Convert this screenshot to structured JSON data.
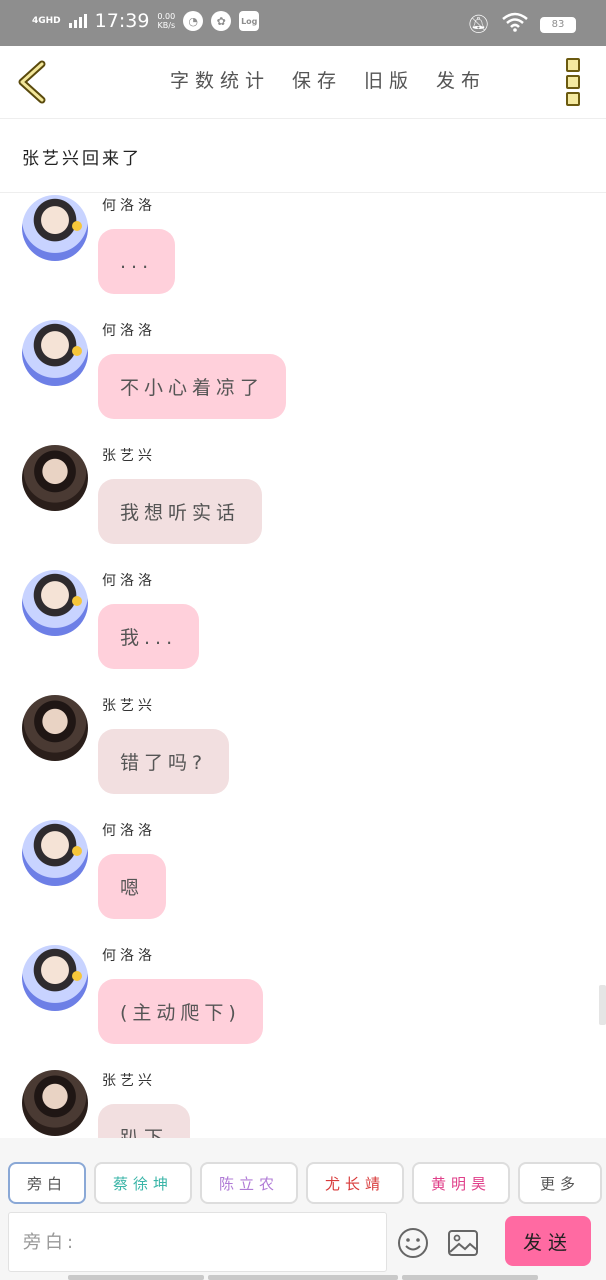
{
  "status_bar": {
    "network": "4GHD",
    "time": "17:39",
    "speed_value": "0.00",
    "speed_unit": "KB/s",
    "app_icon_log": "Log",
    "battery": "83"
  },
  "toolbar": {
    "actions": [
      "字数统计",
      "保存",
      "旧版",
      "发布"
    ]
  },
  "title": "张艺兴回来了",
  "messages": [
    {
      "name": "何洛洛",
      "text": "...",
      "style": "pink",
      "avatar": "light"
    },
    {
      "name": "何洛洛",
      "text": "不小心着凉了",
      "style": "pink",
      "avatar": "light"
    },
    {
      "name": "张艺兴",
      "text": "我想听实话",
      "style": "beige",
      "avatar": "dark"
    },
    {
      "name": "何洛洛",
      "text": "我...",
      "style": "pink",
      "avatar": "light"
    },
    {
      "name": "张艺兴",
      "text": "错了吗?",
      "style": "beige",
      "avatar": "dark"
    },
    {
      "name": "何洛洛",
      "text": "嗯",
      "style": "pink",
      "avatar": "light"
    },
    {
      "name": "何洛洛",
      "text": "(主动爬下)",
      "style": "pink",
      "avatar": "light"
    },
    {
      "name": "张艺兴",
      "text": "趴下",
      "style": "beige",
      "avatar": "dark"
    }
  ],
  "roles": [
    {
      "label": "旁白",
      "color": "#555555"
    },
    {
      "label": "蔡徐坤",
      "color": "#3bb5a8"
    },
    {
      "label": "陈立农",
      "color": "#b07bd6"
    },
    {
      "label": "尤长靖",
      "color": "#d83b3b"
    },
    {
      "label": "黄明昊",
      "color": "#e0408a"
    },
    {
      "label": "更多",
      "color": "#555555"
    }
  ],
  "input": {
    "placeholder": "旁白:"
  },
  "send_label": "发送",
  "colors": {
    "pink_bubble": "#ffd0db",
    "beige_bubble": "#f2dfe0",
    "send": "#ff6aa2",
    "status_bar": "#8e8e8e"
  }
}
